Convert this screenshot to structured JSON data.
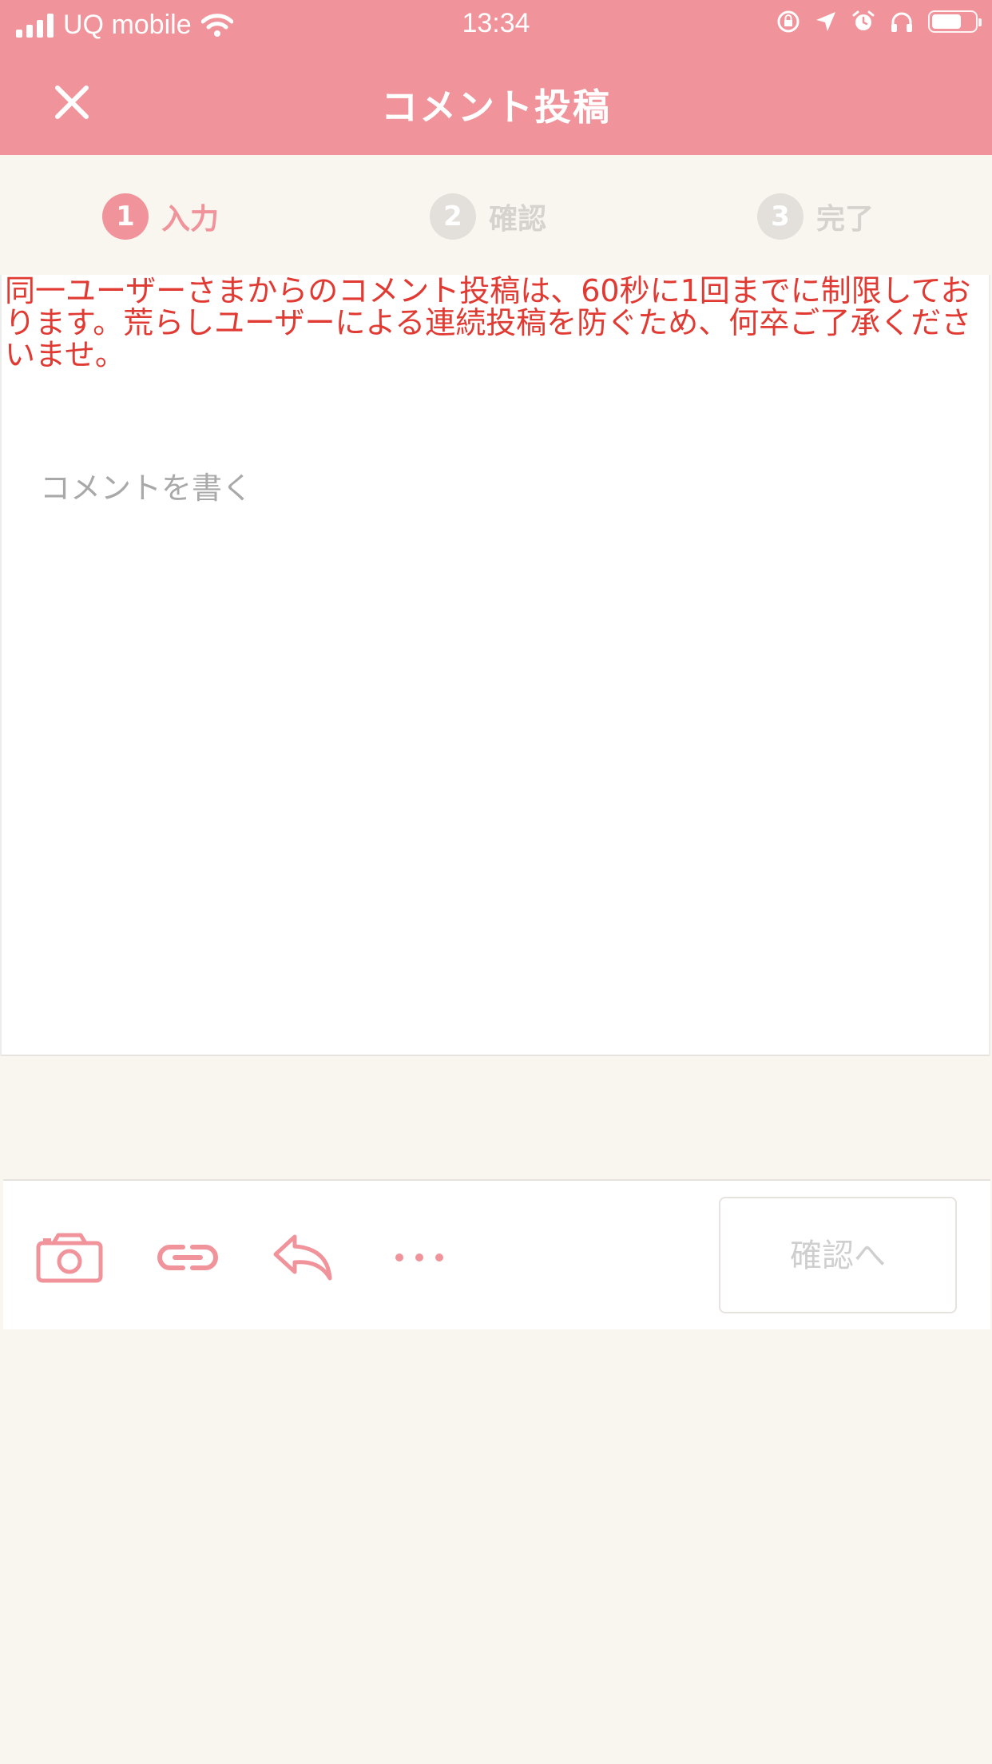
{
  "status_bar": {
    "carrier": "UQ mobile",
    "time": "13:34"
  },
  "header": {
    "title": "コメント投稿"
  },
  "steps": [
    {
      "number": "1",
      "label": "入力",
      "active": true
    },
    {
      "number": "2",
      "label": "確認",
      "active": false
    },
    {
      "number": "3",
      "label": "完了",
      "active": false
    }
  ],
  "notice": {
    "text": "同一ユーザーさまからのコメント投稿は、60秒に1回までに制限しております。荒らしユーザーによる連続投稿を防ぐため、何卒ご了承くださいませ。"
  },
  "comment": {
    "placeholder": "コメントを書く",
    "value": ""
  },
  "toolbar": {
    "confirm_label": "確認へ",
    "tools": [
      "camera-icon",
      "link-icon",
      "reply-icon",
      "more-icon"
    ]
  },
  "colors": {
    "accent": "#f1939a",
    "notice": "#e03a32",
    "background": "#f9f5ef",
    "inactive": "#d6d3cf"
  }
}
